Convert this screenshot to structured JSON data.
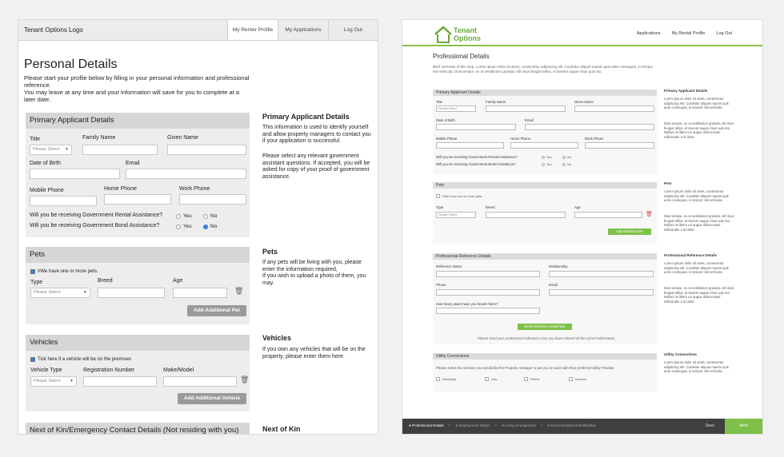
{
  "left": {
    "logo": "Tenant Options Logo",
    "nav": [
      "My Renter Profile",
      "My Applications",
      "Log Out"
    ],
    "title": "Personal Details",
    "intro": "Please start your profile below by filling in your personal information and professional reference.\nYou may leave at any time and your information will save for you to complete at a later date.",
    "primary": {
      "heading": "Primary Applicant Details",
      "title_label": "Title",
      "title_placeholder": "Please Select",
      "family_label": "Family Name",
      "given_label": "Given Name",
      "dob_label": "Date of Birth",
      "email_label": "Email",
      "mobile_label": "Mobile Phone",
      "home_label": "Home Phone",
      "work_label": "Work Phone",
      "q1": "Will you be receiving Government Rental Assistance?",
      "q2": "Will you be receiving Government Bond Assistance?",
      "yes": "Yes",
      "no": "No"
    },
    "pets": {
      "heading": "Pets",
      "check": "I/We have one or more pets.",
      "type_label": "Type",
      "type_placeholder": "Please Select",
      "breed_label": "Breed",
      "age_label": "Age",
      "add": "Add Additional Pet"
    },
    "vehicles": {
      "heading": "Vehicles",
      "check": "Tick here if a vehicle will be on the premises",
      "type_label": "Vehicle Type",
      "type_placeholder": "Please Select",
      "reg_label": "Registration Number",
      "make_label": "Make/Model",
      "add": "Add Additional Vehicle"
    },
    "kin_heading": "Next of Kin/Emergency Contact Details (Not residing with you)",
    "aside": {
      "primary_h": "Primary Applicant Details",
      "primary_t1": "This information is used to identify yourself and allow property managers to contact you if your application is successful.",
      "primary_t2": "Please select any relevant government assistant questions. If accepted, you will be asked for copy of your proof of government assistance.",
      "pets_h": "Pets",
      "pets_t": " If any pets will be living with you, please enter the information required,\nIf you wish to upload a photo of them, you may.",
      "veh_h": "Vehicles",
      "veh_t": "If you own any vehicles that will be on the property, please enter them here.",
      "kin_h": "Next of Kin"
    }
  },
  "right": {
    "logo_line1": "Tenant",
    "logo_line2": "Options",
    "nav": [
      "Applications",
      "My Rental Profile",
      "Log Out"
    ],
    "title": "Professional Details",
    "intro": "Brief overview of this step. Lorem ipsum dolor sit amet, consectetur adipiscing elit. Curabitur aliquet mauris quis ante consequat, in tempor nisl vehicula. Duis tempor, ex ut vestibulum gravida, elit risus feugiat tellus, et laoreet augue risus quis dui.",
    "primary": {
      "heading": "Primary Applicant Details",
      "title_label": "Title",
      "select": "Please Select",
      "family_label": "Family Name",
      "given_label": "Given Name",
      "dob_label": "Date of Birth",
      "email_label": "Email",
      "mobile_label": "Mobile Phone",
      "home_label": "Home Phone",
      "work_label": "Work Phone",
      "q1": "Will you be receiving Government Rental Assistance?",
      "q2": "Will you be receiving Government Bond Assistance?",
      "yes": "Yes",
      "no": "No"
    },
    "pets": {
      "heading": "Pets",
      "check": "I/We have one or more pets.",
      "type_label": "Type",
      "select": "Please Select",
      "breed_label": "Breed",
      "age_label": "Age",
      "add": "Add Additional Pet"
    },
    "prof": {
      "heading": "Professional Reference Details",
      "ref_label": "Reference Name",
      "rel_label": "Relationship",
      "phone_label": "Phone",
      "email_label": "Email",
      "years_label": "How many years have you known them?",
      "send": "Send Reference Email Now",
      "note": "Please send your professional reference once you have entered all the correct information."
    },
    "util": {
      "heading": "Utility Connections",
      "text": "Please select the services you would like the Property manager to put you in touch with their preferred Utility Provider.",
      "options": [
        "Electricity",
        "Gas",
        "Phone",
        "Internet"
      ]
    },
    "side": {
      "h1": "Primary Applicant Details",
      "t1a": "Lorem ipsum dolor sit amet, consectetur adipiscing elit. Curabitur aliquet mauris quis ante consequat, in tempor nisl vehicula.",
      "t1b": "Duis tempor, ex ut vestibulum gravida, elit risus feugiat tellus, et laoreet augue risus quis dui. Nullam at libero eu augue ullamcorper sollicitudin a id dolor.",
      "h2": "Pets",
      "t2a": "Lorem ipsum dolor sit amet, consectetur adipiscing elit. Curabitur aliquet mauris quis ante consequat, in tempor nisl vehicula.",
      "t2b": "Duis tempor, ex ut vestibulum gravida, elit risus feugiat tellus, et laoreet augue risus quis dui. Nullam at libero eu augue ullamcorper sollicitudin a id dolor.",
      "h3": "Professional Reference Details",
      "t3a": "Lorem ipsum dolor sit amet, consectetur adipiscing elit. Curabitur aliquet mauris quis ante consequat, in tempor nisl vehicula.",
      "t3b": "Duis tempor, ex ut vestibulum gravida, elit risus feugiat tellus, et laoreet augue risus quis dui. Nullam at libero eu augue ullamcorper sollicitudin a id dolor.",
      "h4": "Utility Connections",
      "t4": "Lorem ipsum dolor sit amet, consectetur adipiscing elit. Curabitur aliquet mauris quis ante consequat, in tempor nisl vehicula."
    },
    "footer": {
      "steps": [
        "Professional Details",
        ">",
        "Employment Status",
        ">",
        "Living Arrangement",
        ">",
        "Documentation/Identification"
      ],
      "save": "Save",
      "next": "Next"
    },
    "colors": {
      "accent": "#7ec04a",
      "footer": "#3f3f3f"
    }
  }
}
